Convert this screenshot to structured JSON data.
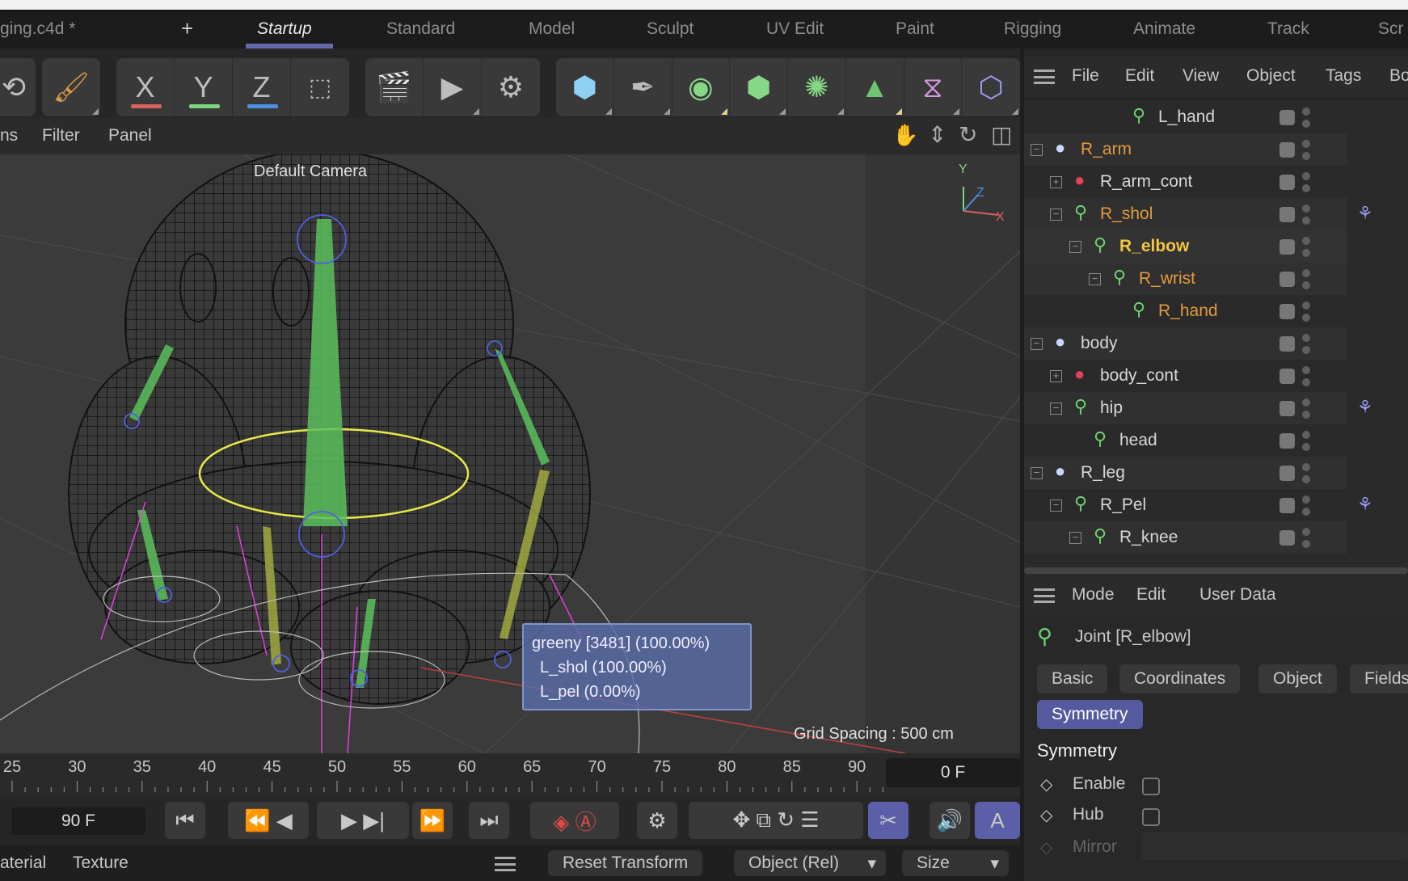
{
  "window": {
    "file_title": "ging.c4d *",
    "add_tab": "+"
  },
  "layouts": [
    {
      "label": "Startup",
      "active": true
    },
    {
      "label": "Standard"
    },
    {
      "label": "Model"
    },
    {
      "label": "Sculpt"
    },
    {
      "label": "UV Edit"
    },
    {
      "label": "Paint"
    },
    {
      "label": "Rigging"
    },
    {
      "label": "Animate"
    },
    {
      "label": "Track"
    },
    {
      "label": "Scr"
    }
  ],
  "toolbar": {
    "axis_x": "X",
    "axis_y": "Y",
    "axis_z": "Z",
    "colors": {
      "x": "#d9625f",
      "y": "#7ed37e",
      "z": "#4a8fe0"
    }
  },
  "viewport": {
    "menu": [
      "ns",
      "Filter",
      "Panel"
    ],
    "camera_label": "Default Camera",
    "grid_spacing": "Grid Spacing : 500 cm",
    "axis": {
      "y": "Y",
      "z": "Z",
      "x": "X"
    },
    "tooltip": [
      "greeny [3481] (100.00%)",
      "L_shol (100.00%)",
      "L_pel (0.00%)"
    ]
  },
  "timeline": {
    "ticks": [
      "25",
      "30",
      "35",
      "40",
      "45",
      "50",
      "55",
      "60",
      "65",
      "70",
      "75",
      "80",
      "85",
      "90"
    ],
    "current_frame": "0 F",
    "end_frame": "90 F"
  },
  "bottom": {
    "material": "aterial",
    "texture": "Texture",
    "reset": "Reset Transform",
    "coord_mode": "Object (Rel)",
    "size_mode": "Size"
  },
  "object_manager": {
    "menu": [
      "File",
      "Edit",
      "View",
      "Object",
      "Tags",
      "Bo"
    ],
    "rows": [
      {
        "name": "L_hand",
        "type": "joint",
        "color": "#d7d7d7",
        "indent": 6
      },
      {
        "name": "R_arm",
        "type": "null",
        "color": "#e39a3c",
        "indent": 2,
        "expander": "−"
      },
      {
        "name": "R_arm_cont",
        "type": "control",
        "color": "#d7d7d7",
        "indent": 3,
        "expander": "+"
      },
      {
        "name": "R_shol",
        "type": "joint",
        "color": "#e39a3c",
        "indent": 3,
        "expander": "−",
        "tag": true
      },
      {
        "name": "R_elbow",
        "type": "joint",
        "color": "#f2c53d",
        "indent": 4,
        "expander": "−",
        "selected": true
      },
      {
        "name": "R_wrist",
        "type": "joint",
        "color": "#e39a3c",
        "indent": 5,
        "expander": "−"
      },
      {
        "name": "R_hand",
        "type": "joint",
        "color": "#e39a3c",
        "indent": 6
      },
      {
        "name": "body",
        "type": "null",
        "color": "#d7d7d7",
        "indent": 2,
        "expander": "−"
      },
      {
        "name": "body_cont",
        "type": "control",
        "color": "#d7d7d7",
        "indent": 3,
        "expander": "+"
      },
      {
        "name": "hip",
        "type": "joint",
        "color": "#d7d7d7",
        "indent": 3,
        "expander": "−",
        "tag": true
      },
      {
        "name": "head",
        "type": "joint",
        "color": "#d7d7d7",
        "indent": 4
      },
      {
        "name": "R_leg",
        "type": "null",
        "color": "#d7d7d7",
        "indent": 2,
        "expander": "−"
      },
      {
        "name": "R_Pel",
        "type": "joint",
        "color": "#d7d7d7",
        "indent": 3,
        "expander": "−",
        "tag": true
      },
      {
        "name": "R_knee",
        "type": "joint",
        "color": "#d7d7d7",
        "indent": 4,
        "expander": "−"
      }
    ]
  },
  "attributes": {
    "menu": [
      "Mode",
      "Edit",
      "User Data"
    ],
    "object_title": "Joint [R_elbow]",
    "tabs": [
      "Basic",
      "Coordinates",
      "Object",
      "Fields"
    ],
    "active_tab": "Symmetry",
    "section": "Symmetry",
    "fields": [
      {
        "label": "Enable",
        "checked": false
      },
      {
        "label": "Hub",
        "checked": false
      },
      {
        "label": "Mirror",
        "disabled": true
      }
    ],
    "accent": "#555a9e"
  }
}
